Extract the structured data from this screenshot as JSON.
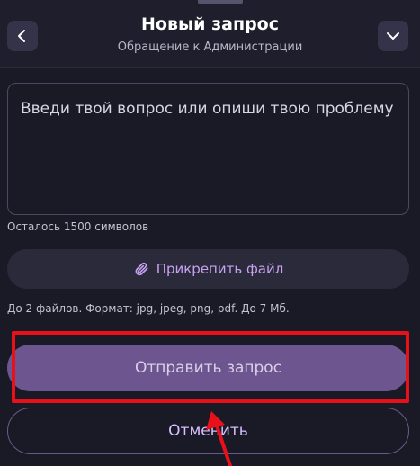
{
  "header": {
    "title": "Новый запрос",
    "subtitle": "Обращение к Администрации",
    "back_icon": "chevron-left-icon",
    "collapse_icon": "chevron-down-icon"
  },
  "form": {
    "question_placeholder": "Введи твой вопрос или опиши твою проблему",
    "counter": "Осталось 1500 символов",
    "attach_label": "Прикрепить файл",
    "attach_icon": "paperclip-icon",
    "file_hint": "До 2 файлов. Формат: jpg, jpeg, png, pdf. До 7 Мб."
  },
  "actions": {
    "submit_label": "Отправить запрос",
    "cancel_label": "Отменить"
  },
  "annotation": {
    "highlight_color": "#e8111a"
  },
  "colors": {
    "background": "#1a1a26",
    "accent": "#6d5690",
    "accent_text": "#c6a2f0"
  }
}
